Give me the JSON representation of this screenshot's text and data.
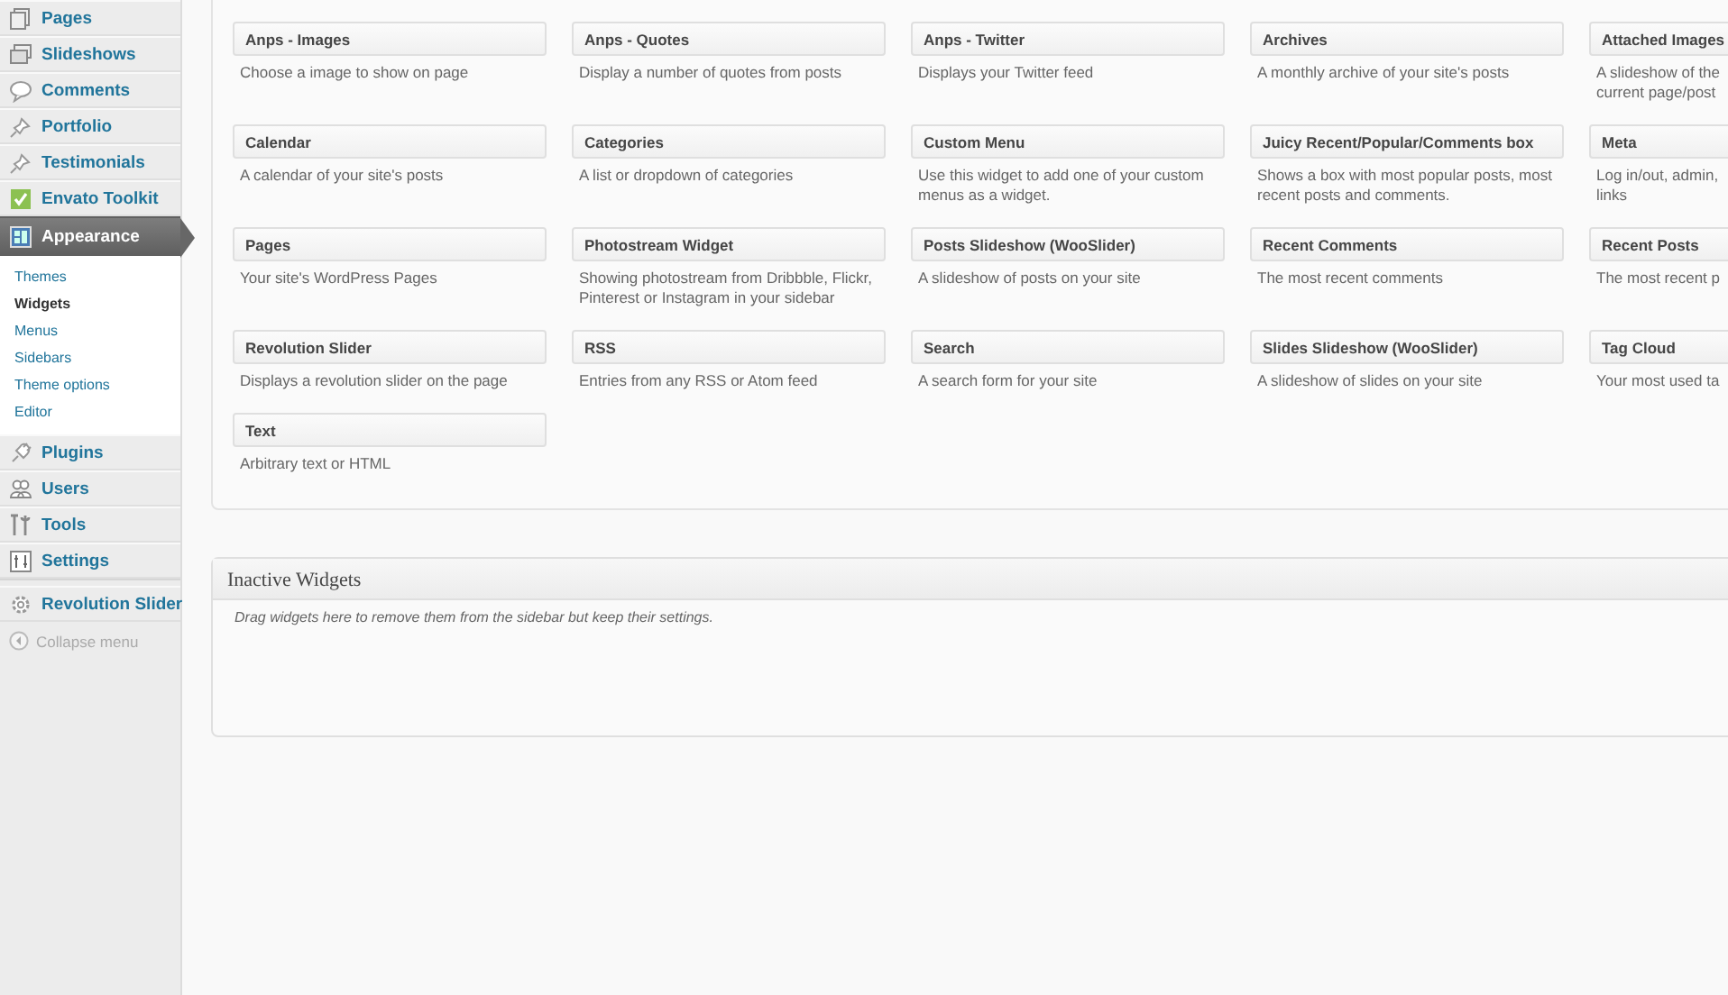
{
  "sidebar": {
    "items": [
      {
        "label": "Pages",
        "selected": false
      },
      {
        "label": "Slideshows",
        "selected": false
      },
      {
        "label": "Comments",
        "selected": false
      },
      {
        "label": "Portfolio",
        "selected": false
      },
      {
        "label": "Testimonials",
        "selected": false
      },
      {
        "label": "Envato Toolkit",
        "selected": false
      },
      {
        "label": "Appearance",
        "selected": true,
        "children": [
          {
            "label": "Themes",
            "selected": false
          },
          {
            "label": "Widgets",
            "selected": true
          },
          {
            "label": "Menus",
            "selected": false
          },
          {
            "label": "Sidebars",
            "selected": false
          },
          {
            "label": "Theme options",
            "selected": false
          },
          {
            "label": "Editor",
            "selected": false
          }
        ]
      },
      {
        "label": "Plugins",
        "selected": false
      },
      {
        "label": "Users",
        "selected": false
      },
      {
        "label": "Tools",
        "selected": false
      },
      {
        "label": "Settings",
        "selected": false
      },
      {
        "label": "Revolution Slider",
        "selected": false
      }
    ],
    "collapse_menu": "Collapse menu"
  },
  "available_widgets": [
    {
      "title": "Anps - Images",
      "description": "Choose a image to show on page"
    },
    {
      "title": "Anps - Quotes",
      "description": "Display a number of quotes from posts"
    },
    {
      "title": "Anps - Twitter",
      "description": "Displays your Twitter feed"
    },
    {
      "title": "Archives",
      "description": "A monthly archive of your site's posts"
    },
    {
      "title": "Attached Images",
      "description": "A slideshow of the current page/post"
    },
    {
      "title": "Calendar",
      "description": "A calendar of your site's posts"
    },
    {
      "title": "Categories",
      "description": "A list or dropdown of categories"
    },
    {
      "title": "Custom Menu",
      "description": "Use this widget to add one of your custom menus as a widget."
    },
    {
      "title": "Juicy Recent/Popular/Comments box",
      "description": "Shows a box with most popular posts, most recent posts and comments."
    },
    {
      "title": "Meta",
      "description": "Log in/out, admin, links"
    },
    {
      "title": "Pages",
      "description": "Your site's WordPress Pages"
    },
    {
      "title": "Photostream Widget",
      "description": "Showing photostream from Dribbble, Flickr, Pinterest or Instagram in your sidebar"
    },
    {
      "title": "Posts Slideshow (WooSlider)",
      "description": "A slideshow of posts on your site"
    },
    {
      "title": "Recent Comments",
      "description": "The most recent comments"
    },
    {
      "title": "Recent Posts",
      "description": "The most recent p"
    },
    {
      "title": "Revolution Slider",
      "description": "Displays a revolution slider on the page"
    },
    {
      "title": "RSS",
      "description": "Entries from any RSS or Atom feed"
    },
    {
      "title": "Search",
      "description": "A search form for your site"
    },
    {
      "title": "Slides Slideshow (WooSlider)",
      "description": "A slideshow of slides on your site"
    },
    {
      "title": "Tag Cloud",
      "description": "Your most used ta"
    },
    {
      "title": "Text",
      "description": "Arbitrary text or HTML"
    }
  ],
  "inactive_widgets": {
    "title": "Inactive Widgets",
    "description": "Drag widgets here to remove them from the sidebar but keep their settings."
  }
}
